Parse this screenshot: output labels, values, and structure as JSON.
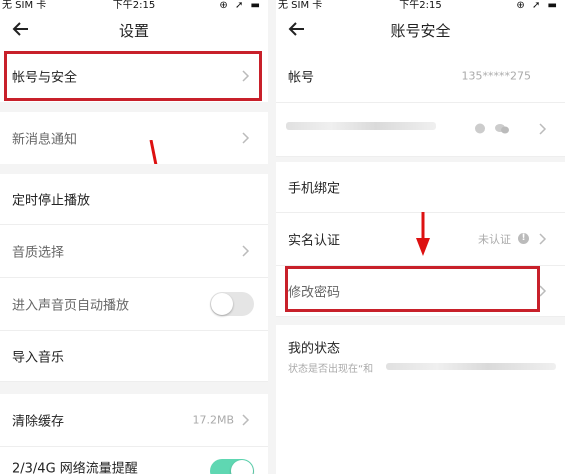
{
  "left": {
    "status": {
      "carrier": "无 SIM 卡",
      "time": "下午2:15"
    },
    "title": "设置",
    "rows": {
      "account_security": "帐号与安全",
      "notification": "新消息通知",
      "sleep_timer": "定时停止播放",
      "sound_quality": "音质选择",
      "auto_play": "进入声音页自动播放",
      "import_music": "导入音乐",
      "clear_cache": "清除缓存",
      "cache_size": "17.2MB",
      "data_alert": "2/3/4G 网络流量提醒"
    },
    "toggles": {
      "auto_play": false,
      "data_alert": true
    }
  },
  "right": {
    "status": {
      "carrier": "无 SIM 卡",
      "time": "下午2:15"
    },
    "title": "账号安全",
    "rows": {
      "account": "帐号",
      "account_value": "135*****275",
      "phone_binding": "手机绑定",
      "real_name": "实名认证",
      "real_name_status": "未认证",
      "change_password": "修改密码",
      "my_status": "我的状态",
      "my_status_sub": "状态是否出现在“和"
    }
  },
  "colors": {
    "highlight": "#c8202a",
    "toggle_on": "#5fd7b2"
  }
}
